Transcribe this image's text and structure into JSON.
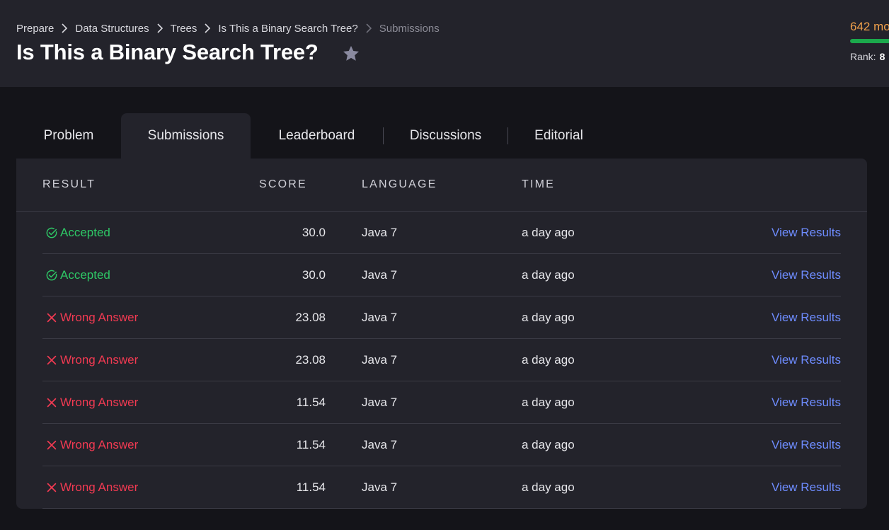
{
  "breadcrumb": [
    {
      "label": "Prepare"
    },
    {
      "label": "Data Structures"
    },
    {
      "label": "Trees"
    },
    {
      "label": "Is This a Binary Search Tree?"
    },
    {
      "label": "Submissions"
    }
  ],
  "page_title": "Is This a Binary Search Tree?",
  "profile": {
    "score_text": "642 mo",
    "rank_label": "Rank:",
    "rank_value": "8",
    "progress_fraction": 0.9,
    "progress_color": "#1ba94c"
  },
  "tabs": [
    {
      "label": "Problem",
      "active": false
    },
    {
      "label": "Submissions",
      "active": true
    },
    {
      "label": "Leaderboard",
      "active": false
    },
    {
      "label": "Discussions",
      "active": false
    },
    {
      "label": "Editorial",
      "active": false
    }
  ],
  "table": {
    "headers": {
      "result": "RESULT",
      "score": "SCORE",
      "language": "LANGUAGE",
      "time": "TIME"
    },
    "rows": [
      {
        "status": "accepted",
        "result": "Accepted",
        "score": "30.0",
        "language": "Java 7",
        "time": "a day ago",
        "action": "View Results"
      },
      {
        "status": "accepted",
        "result": "Accepted",
        "score": "30.0",
        "language": "Java 7",
        "time": "a day ago",
        "action": "View Results"
      },
      {
        "status": "wrong",
        "result": "Wrong Answer",
        "score": "23.08",
        "language": "Java 7",
        "time": "a day ago",
        "action": "View Results"
      },
      {
        "status": "wrong",
        "result": "Wrong Answer",
        "score": "23.08",
        "language": "Java 7",
        "time": "a day ago",
        "action": "View Results"
      },
      {
        "status": "wrong",
        "result": "Wrong Answer",
        "score": "11.54",
        "language": "Java 7",
        "time": "a day ago",
        "action": "View Results"
      },
      {
        "status": "wrong",
        "result": "Wrong Answer",
        "score": "11.54",
        "language": "Java 7",
        "time": "a day ago",
        "action": "View Results"
      },
      {
        "status": "wrong",
        "result": "Wrong Answer",
        "score": "11.54",
        "language": "Java 7",
        "time": "a day ago",
        "action": "View Results"
      }
    ]
  },
  "icons": {
    "breadcrumb_separator": "chevron-right-icon",
    "bookmark": "star-icon",
    "accepted": "check-circle-icon",
    "wrong": "close-icon"
  },
  "colors": {
    "accepted": "#2ec866",
    "wrong": "#f23a52",
    "link": "#6e8cff",
    "score_orange": "#f0a04b"
  }
}
